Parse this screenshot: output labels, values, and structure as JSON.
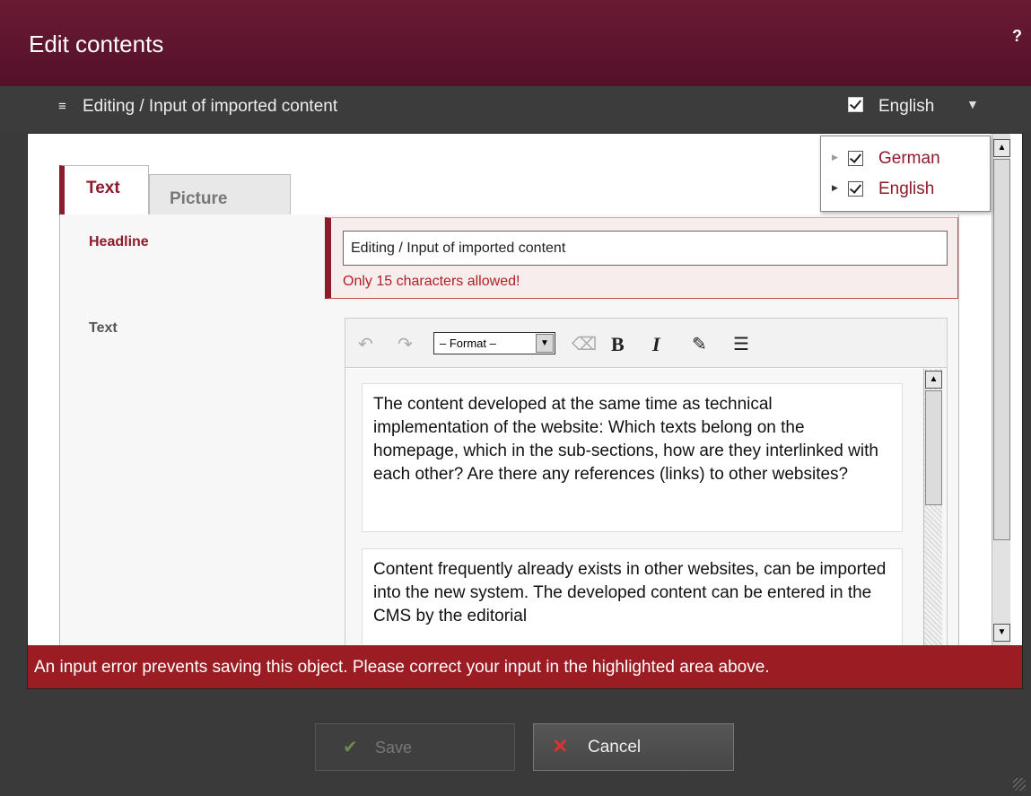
{
  "window": {
    "title": "Edit contents",
    "help_label": "?"
  },
  "subbar": {
    "subtitle": "Editing / Input of imported content",
    "language_selected": "English",
    "language_checked": true
  },
  "tabs": [
    {
      "label": "Text",
      "active": true
    },
    {
      "label": "Picture",
      "active": false
    }
  ],
  "language_dropdown": [
    {
      "label": "German",
      "checked": true
    },
    {
      "label": "English",
      "checked": true
    }
  ],
  "fields": {
    "headline": {
      "label": "Headline",
      "value": "Editing / Input of imported content",
      "error": "Only 15 characters allowed!"
    },
    "text": {
      "label": "Text",
      "format_select": "– Format –",
      "paragraphs": [
        "The content developed at the same time as technical implementation of the website: Which texts belong on the homepage, which in the sub-sections, how are they interlinked with each other? Are there any references (links) to other websites?",
        "Content frequently already exists in other websites, can be imported into the new system. The developed content can be entered in the CMS by the editorial"
      ]
    }
  },
  "toolbar_icons": [
    "undo-icon",
    "redo-icon",
    "eraser-icon",
    "bold-icon",
    "italic-icon",
    "insert-link-icon",
    "list-icon"
  ],
  "error_message": "An input error prevents saving this object. Please correct your input in the highlighted area above.",
  "buttons": {
    "save": "Save",
    "cancel": "Cancel"
  },
  "colors": {
    "title_bar": "#5f1530",
    "accent": "#8e1b2c",
    "error_bar": "#9b1c22"
  }
}
